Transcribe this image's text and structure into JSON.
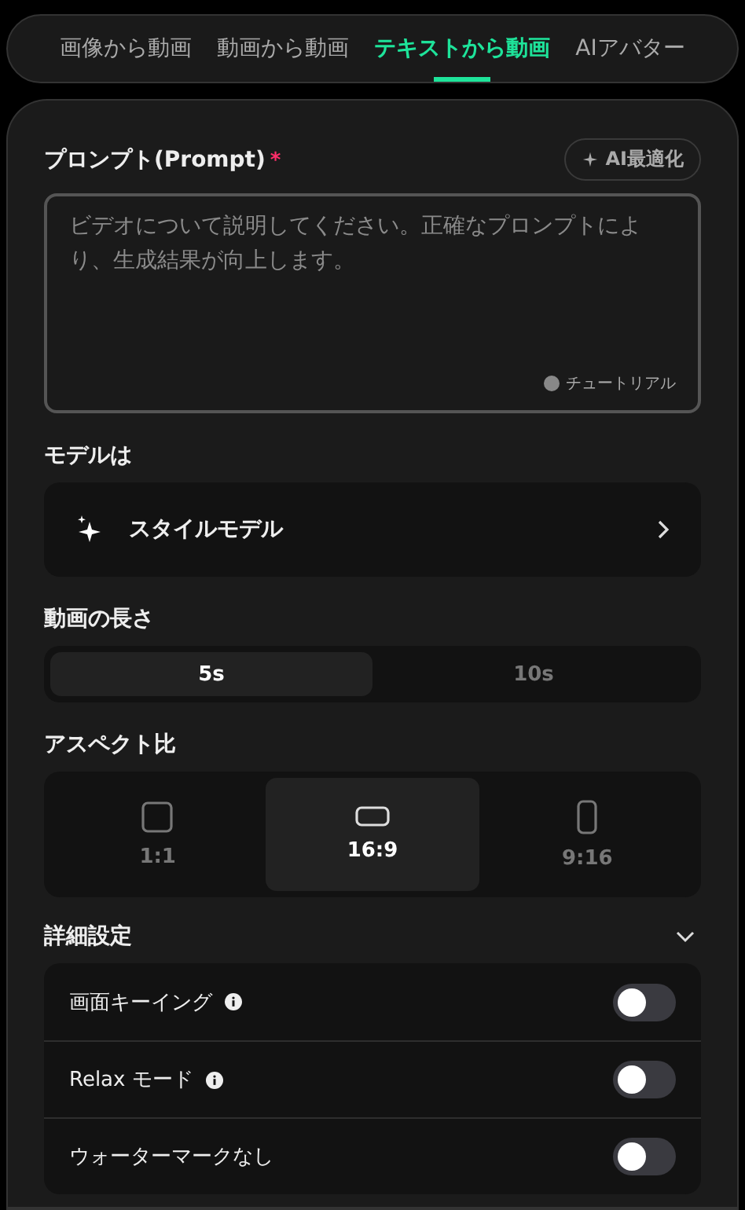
{
  "tabs": [
    {
      "label": "画像から動画",
      "selected": false
    },
    {
      "label": "動画から動画",
      "selected": false
    },
    {
      "label": "テキストから動画",
      "selected": true
    },
    {
      "label": "AIアバター",
      "selected": false
    }
  ],
  "prompt": {
    "label": "プロンプト(Prompt)",
    "required_mark": "*",
    "optimize_button": "AI最適化",
    "placeholder": "ビデオについて説明してください。正確なプロンプトにより、生成結果が向上します。",
    "tutorial_link": "チュートリアル"
  },
  "model": {
    "label": "モデルは",
    "value": "スタイルモデル"
  },
  "duration": {
    "label": "動画の長さ",
    "options": [
      {
        "label": "5s",
        "selected": true
      },
      {
        "label": "10s",
        "selected": false
      }
    ]
  },
  "aspect": {
    "label": "アスペクト比",
    "options": [
      {
        "label": "1:1",
        "kind": "square",
        "selected": false
      },
      {
        "label": "16:9",
        "kind": "wide",
        "selected": true
      },
      {
        "label": "9:16",
        "kind": "tall",
        "selected": false
      }
    ]
  },
  "advanced": {
    "label": "詳細設定",
    "expanded": true,
    "settings": [
      {
        "label": "画面キーイング",
        "info": true,
        "on": false
      },
      {
        "label": "Relax モード",
        "info": true,
        "on": false
      },
      {
        "label": "ウォーターマークなし",
        "info": false,
        "on": false
      }
    ]
  }
}
